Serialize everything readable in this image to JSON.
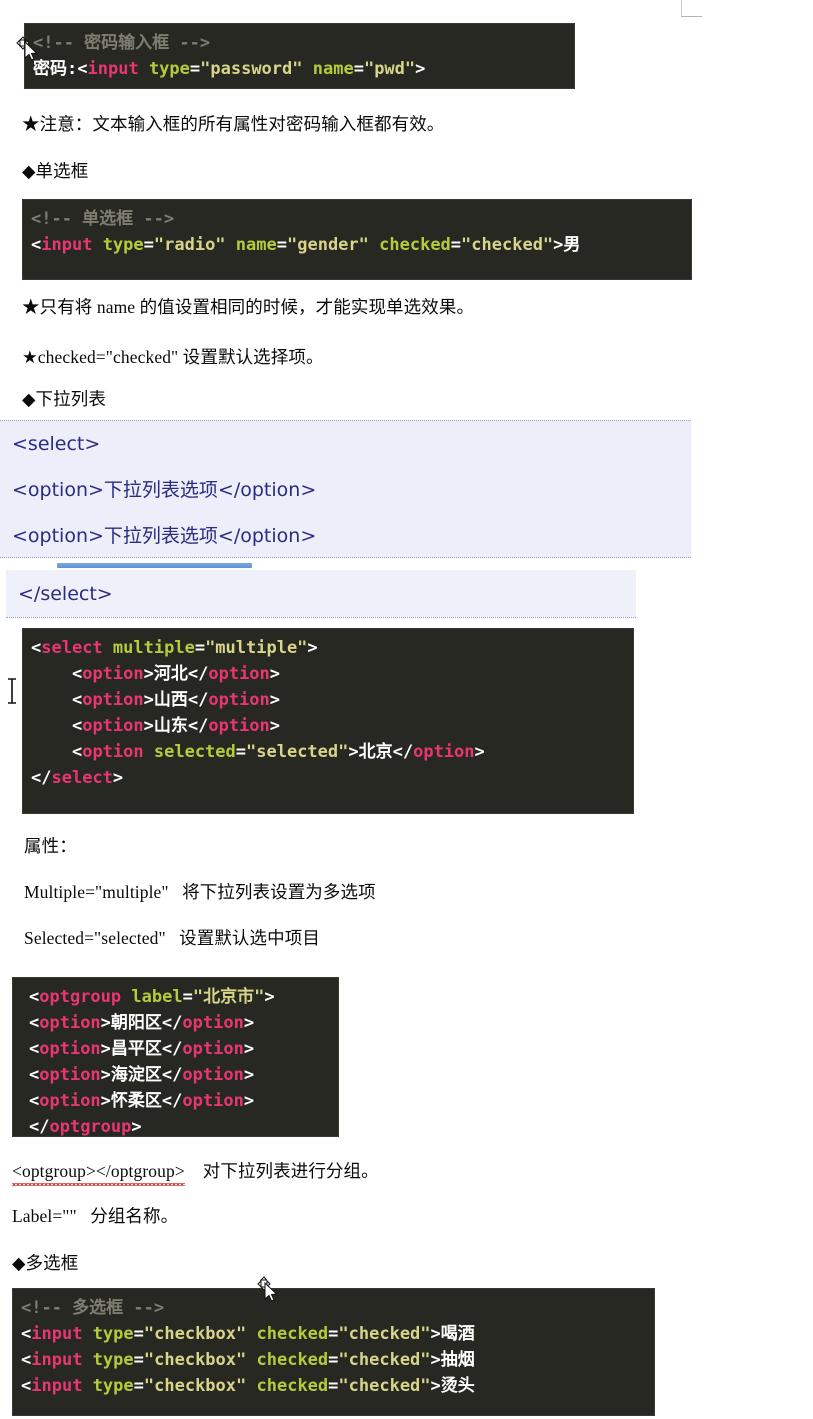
{
  "document": {
    "language": "zh-CN",
    "background": "#ffffff",
    "code_dark_bg": "#282822",
    "code_light_bg": "#eceefa",
    "accent_blue": "#5d93d4"
  },
  "sections": {
    "password": {
      "code": {
        "comment": "<!-- 密码输入框 -->",
        "label": "密码:",
        "tag_open": "<",
        "tag_name": "input",
        "attr1_name": "type",
        "attr1_value": "\"password\"",
        "attr2_name": "name",
        "attr2_value": "\"pwd\"",
        "tag_close": ">"
      },
      "note": "★注意：文本输入框的所有属性对密码输入框都有效。"
    },
    "radio": {
      "heading": "◆单选框",
      "code": {
        "comment": "<!-- 单选框 -->",
        "tag_name": "input",
        "attr1_name": "type",
        "attr1_value": "\"radio\"",
        "attr2_name": "name",
        "attr2_value": "\"gender\"",
        "attr3_name": "checked",
        "attr3_value": "\"checked\"",
        "text_after": "男"
      },
      "note1": "★只有将 name 的值设置相同的时候，才能实现单选效果。",
      "note2": "★checked=\"checked\" 设置默认选择项。"
    },
    "select": {
      "heading": "◆下拉列表",
      "lines": [
        "<select>",
        "<option>下拉列表选项</option>",
        "<option>下拉列表选项</option>"
      ],
      "closing_line": "</select>",
      "code": {
        "line1_tag": "select",
        "line1_attr_name": "multiple",
        "line1_attr_value": "\"multiple\"",
        "opt1_text": "河北",
        "opt2_text": "山西",
        "opt3_text": "山东",
        "opt4_attr_name": "selected",
        "opt4_attr_value": "\"selected\"",
        "opt4_text": "北京",
        "option_tag": "option",
        "close_tag": "select"
      },
      "attributes_title": "属性：",
      "attr_rows": [
        {
          "name": "Multiple=\"multiple\"",
          "desc": "将下拉列表设置为多选项"
        },
        {
          "name": "Selected=\"selected\"",
          "desc": "设置默认选中项目"
        }
      ]
    },
    "optgroup": {
      "code": {
        "tag_name": "optgroup",
        "attr_name": "label",
        "attr_value": "\"北京市\"",
        "option_tag": "option",
        "options": [
          "朝阳区",
          "昌平区",
          "海淀区",
          "怀柔区"
        ],
        "close_tag": "optgroup"
      },
      "note_tag": "<optgroup></optgroup>",
      "note_desc": "对下拉列表进行分组。",
      "label_note": "Label=\"\"",
      "label_desc": "分组名称。"
    },
    "checkbox": {
      "heading": "◆多选框",
      "code": {
        "comment": "<!-- 多选框 -->",
        "tag_name": "input",
        "attr1_name": "type",
        "attr1_value": "\"checkbox\"",
        "attr2_name": "checked",
        "attr2_value": "\"checked\"",
        "labels": [
          "喝酒",
          "抽烟",
          "烫头"
        ]
      }
    }
  },
  "cursors": {
    "move_cursor_top": "move-cursor",
    "ibeam_cursor": "text-ibeam-cursor",
    "move_cursor_bottom": "move-cursor"
  }
}
